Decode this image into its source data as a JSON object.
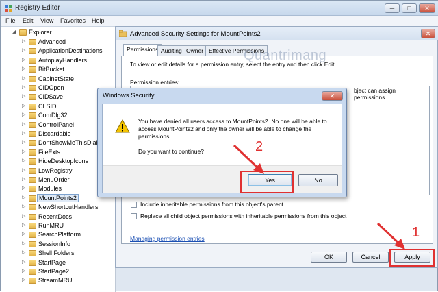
{
  "registry": {
    "title": "Registry Editor",
    "menu": [
      "File",
      "Edit",
      "View",
      "Favorites",
      "Help"
    ],
    "tree": {
      "root": "Explorer",
      "items": [
        "Advanced",
        "ApplicationDestinations",
        "AutoplayHandlers",
        "BitBucket",
        "CabinetState",
        "CIDOpen",
        "CIDSave",
        "CLSID",
        "ComDlg32",
        "ControlPanel",
        "Discardable",
        "DontShowMeThisDialo",
        "FileExts",
        "HideDesktopIcons",
        "LowRegistry",
        "MenuOrder",
        "Modules",
        "MountPoints2",
        "NewShortcutHandlers",
        "RecentDocs",
        "RunMRU",
        "SearchPlatform",
        "SessionInfo",
        "Shell Folders",
        "StartPage",
        "StartPage2",
        "StreamMRU"
      ],
      "selected": "MountPoints2"
    }
  },
  "advanced": {
    "title": "Advanced Security Settings for MountPoints2",
    "tabs": [
      "Permissions",
      "Auditing",
      "Owner",
      "Effective Permissions"
    ],
    "instructions": "To view or edit details for a permission entry, select the entry and then click Edit.",
    "entries_label": "Permission entries:",
    "partial_text": "bject can assign permissions.",
    "checkbox_inherit": "Include inheritable permissions from this object's parent",
    "checkbox_replace": "Replace all child object permissions with inheritable permissions from this object",
    "link": "Managing permission entries",
    "ok": "OK",
    "cancel": "Cancel",
    "apply": "Apply"
  },
  "security": {
    "title": "Windows Security",
    "message": "You have denied all users access to MountPoints2. No one will be able to access MountPoints2 and only the owner will be able to change the permissions.",
    "question": "Do you want to continue?",
    "yes": "Yes",
    "no": "No"
  },
  "annotations": {
    "step1": "1",
    "step2": "2"
  },
  "watermark": "Quantrimang",
  "colors": {
    "highlight": "#e03131",
    "link": "#1a4fb3",
    "warning": "#f5c400"
  }
}
